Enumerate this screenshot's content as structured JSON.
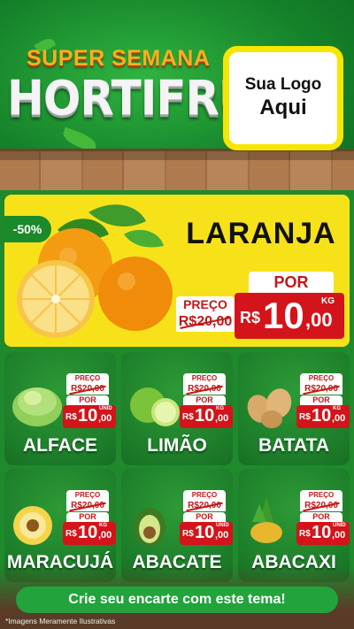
{
  "header": {
    "super_semana": "SUPER SEMANA",
    "hortifruti": "HORTIFRUTI",
    "logo_line1": "Sua Logo",
    "logo_line2": "Aqui"
  },
  "featured": {
    "badge": "-50%",
    "name": "LARANJA",
    "preco_label": "PREÇO",
    "old_price": "R$20,00",
    "por_label": "POR",
    "currency": "R$",
    "new_int": "10",
    "new_dec": ",00",
    "unit": "KG"
  },
  "products": [
    {
      "name": "ALFACE",
      "preco_label": "PREÇO",
      "old_price": "R$20,00",
      "por_label": "POR",
      "currency": "R$",
      "new_int": "10",
      "new_dec": ",00",
      "unit": "UNID"
    },
    {
      "name": "LIMÃO",
      "preco_label": "PREÇO",
      "old_price": "R$20,00",
      "por_label": "POR",
      "currency": "R$",
      "new_int": "10",
      "new_dec": ",00",
      "unit": "KG"
    },
    {
      "name": "BATATA",
      "preco_label": "PREÇO",
      "old_price": "R$20,00",
      "por_label": "POR",
      "currency": "R$",
      "new_int": "10",
      "new_dec": ",00",
      "unit": "KG"
    },
    {
      "name": "MARACUJÁ",
      "preco_label": "PREÇO",
      "old_price": "R$20,00",
      "por_label": "POR",
      "currency": "R$",
      "new_int": "10",
      "new_dec": ",00",
      "unit": "KG"
    },
    {
      "name": "ABACATE",
      "preco_label": "PREÇO",
      "old_price": "R$20,00",
      "por_label": "POR",
      "currency": "R$",
      "new_int": "10",
      "new_dec": ",00",
      "unit": "UNID"
    },
    {
      "name": "ABACAXI",
      "preco_label": "PREÇO",
      "old_price": "R$20,00",
      "por_label": "POR",
      "currency": "R$",
      "new_int": "10",
      "new_dec": ",00",
      "unit": "UNID"
    }
  ],
  "cta": "Crie seu encarte com este tema!",
  "disclaimer": "*Imagens Meramente Ilustrativas",
  "colors": {
    "green": "#1e8a2c",
    "yellow": "#f7e21a",
    "red": "#d3141a",
    "gold": "#f5b21b"
  },
  "icons": [
    "orange-icon",
    "lettuce-icon",
    "lime-icon",
    "potato-icon",
    "passion-fruit-icon",
    "avocado-icon",
    "pineapple-icon"
  ]
}
